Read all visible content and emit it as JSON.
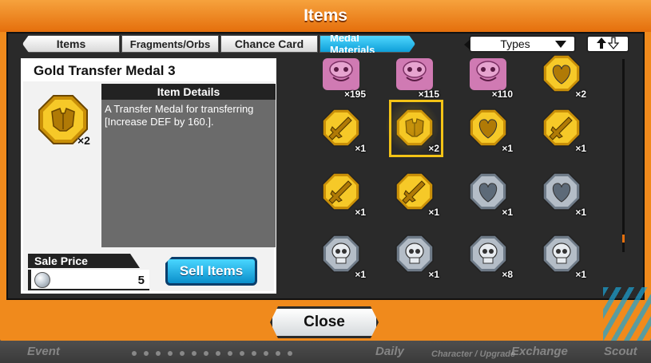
{
  "window": {
    "title": "Items"
  },
  "tabs": [
    {
      "label": "Items",
      "active": false
    },
    {
      "label": "Fragments/Orbs",
      "active": false
    },
    {
      "label": "Chance Card",
      "active": false
    },
    {
      "label": "Medal Materials",
      "active": true
    }
  ],
  "filter": {
    "types_label": "Types",
    "sort_icon": "up-down-arrows-icon"
  },
  "detail": {
    "item_name": "Gold Transfer Medal 3",
    "item_icon": "gold-defense-medal-icon",
    "count": "×2",
    "details_header": "Item Details",
    "description": "A Transfer Medal for transferring [Increase DEF by 160.].",
    "sale_label": "Sale Price",
    "sale_coin_icon": "silver-coin-icon",
    "sale_value": "5",
    "sell_button": "Sell Items"
  },
  "grid": {
    "items": [
      {
        "icon": "pink-character-icon",
        "count": "×195",
        "selected": false
      },
      {
        "icon": "pink-character-icon",
        "count": "×115",
        "selected": false
      },
      {
        "icon": "pink-character-icon",
        "count": "×110",
        "selected": false
      },
      {
        "icon": "gold-heart-medal-icon",
        "count": "×2",
        "selected": false
      },
      {
        "icon": "gold-sword-medal-icon",
        "count": "×1",
        "selected": false
      },
      {
        "icon": "gold-defense-medal-icon",
        "count": "×2",
        "selected": true
      },
      {
        "icon": "gold-heart-medal-icon",
        "count": "×1",
        "selected": false
      },
      {
        "icon": "gold-sword-medal-icon",
        "count": "×1",
        "selected": false
      },
      {
        "icon": "gold-sword-medal-icon",
        "count": "×1",
        "selected": false
      },
      {
        "icon": "gold-sword-medal-icon",
        "count": "×1",
        "selected": false
      },
      {
        "icon": "silver-heart-medal-icon",
        "count": "×1",
        "selected": false
      },
      {
        "icon": "silver-heart-medal-icon",
        "count": "×1",
        "selected": false
      },
      {
        "icon": "silver-skull-medal-icon",
        "count": "×1",
        "selected": false
      },
      {
        "icon": "silver-skull-medal-icon",
        "count": "×1",
        "selected": false
      },
      {
        "icon": "silver-skull-medal-icon",
        "count": "×8",
        "selected": false
      },
      {
        "icon": "silver-skull-medal-icon",
        "count": "×1",
        "selected": false
      }
    ]
  },
  "close_button": "Close",
  "background_nav": [
    "Event",
    "Daily",
    "Character / Upgrade",
    "Exchange",
    "Scout"
  ],
  "colors": {
    "accent": "#f08a1c",
    "tab_active": "#0e9fd8",
    "gold": "#f3c316",
    "silver": "#aeb6c0"
  }
}
